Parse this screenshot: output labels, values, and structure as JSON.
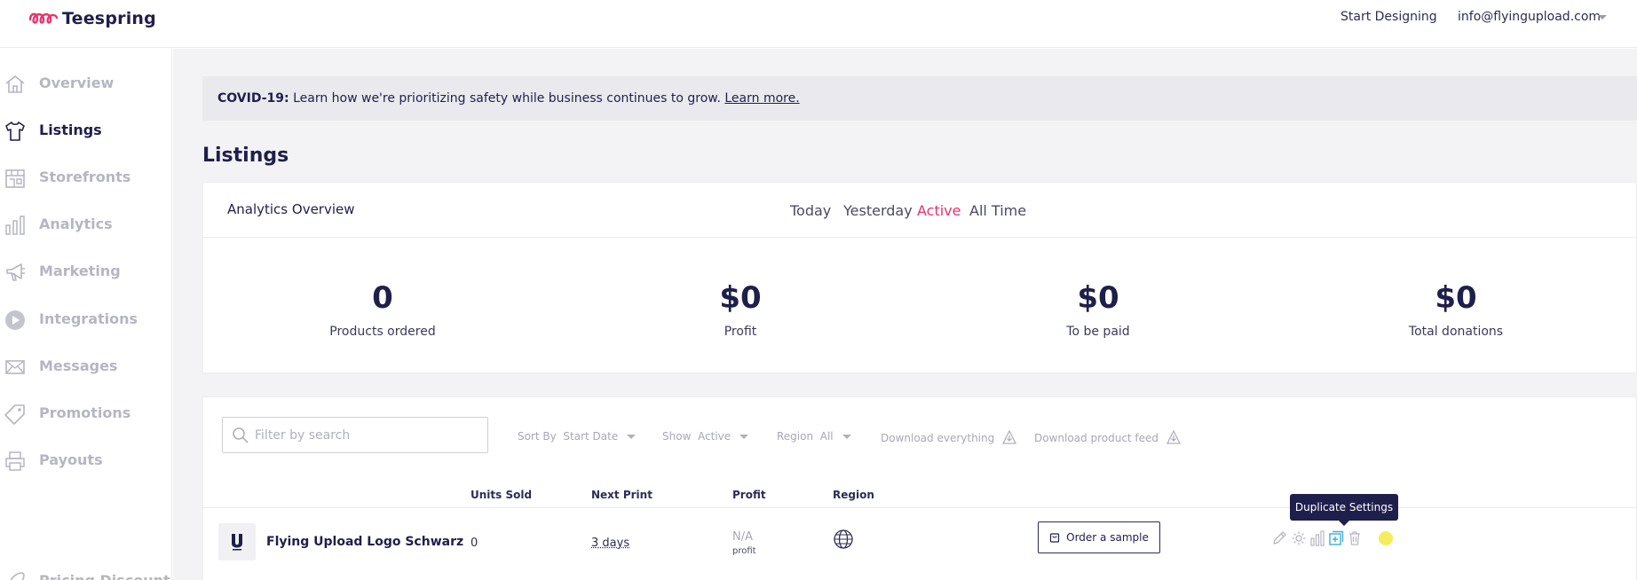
{
  "header": {
    "logo_text": "Teespring",
    "start_designing": "Start Designing",
    "account_email": "info@flyingupload.com"
  },
  "sidebar": {
    "items": [
      {
        "label": "Overview",
        "icon": "home-icon"
      },
      {
        "label": "Listings",
        "icon": "tshirt-icon",
        "active": true
      },
      {
        "label": "Storefronts",
        "icon": "storefront-icon"
      },
      {
        "label": "Analytics",
        "icon": "bar-chart-icon"
      },
      {
        "label": "Marketing",
        "icon": "megaphone-icon"
      },
      {
        "label": "Integrations",
        "icon": "play-icon"
      },
      {
        "label": "Messages",
        "icon": "envelope-icon"
      },
      {
        "label": "Promotions",
        "icon": "tag-icon"
      },
      {
        "label": "Payouts",
        "icon": "printer-icon"
      },
      {
        "label": "Pricing Discount",
        "icon": "rocket-icon"
      }
    ]
  },
  "banner": {
    "prefix": "COVID-19:",
    "text": " Learn how we're prioritizing safety while business continues to grow. ",
    "link": "Learn more."
  },
  "page_title": "Listings",
  "analytics": {
    "title": "Analytics Overview",
    "tabs": [
      "Today",
      "Yesterday",
      "Active",
      "All Time"
    ],
    "active_tab": "Active",
    "stats": [
      {
        "value": "0",
        "label": "Products ordered"
      },
      {
        "value": "$0",
        "label": "Profit"
      },
      {
        "value": "$0",
        "label": "To be paid"
      },
      {
        "value": "$0",
        "label": "Total donations"
      }
    ]
  },
  "filters": {
    "search_placeholder": "Filter by search",
    "sort_label": "Sort By",
    "sort_value": "Start Date",
    "show_label": "Show",
    "show_value": "Active",
    "region_label": "Region",
    "region_value": "All",
    "download_everything": "Download everything",
    "download_feed": "Download product feed"
  },
  "table": {
    "columns": [
      "Units Sold",
      "Next Print",
      "Profit",
      "Region"
    ],
    "rows": [
      {
        "name": "Flying Upload Logo Schwarz",
        "units_sold": "0",
        "next_print": "3 days",
        "profit": "N/A",
        "profit_sub": "profit",
        "order_sample": "Order a sample"
      }
    ]
  },
  "tooltip": "Duplicate Settings",
  "colors": {
    "brand": "#e8336b",
    "navy": "#1f1f4b",
    "muted": "#b6b6c2",
    "highlight": "#f5ec5c"
  }
}
